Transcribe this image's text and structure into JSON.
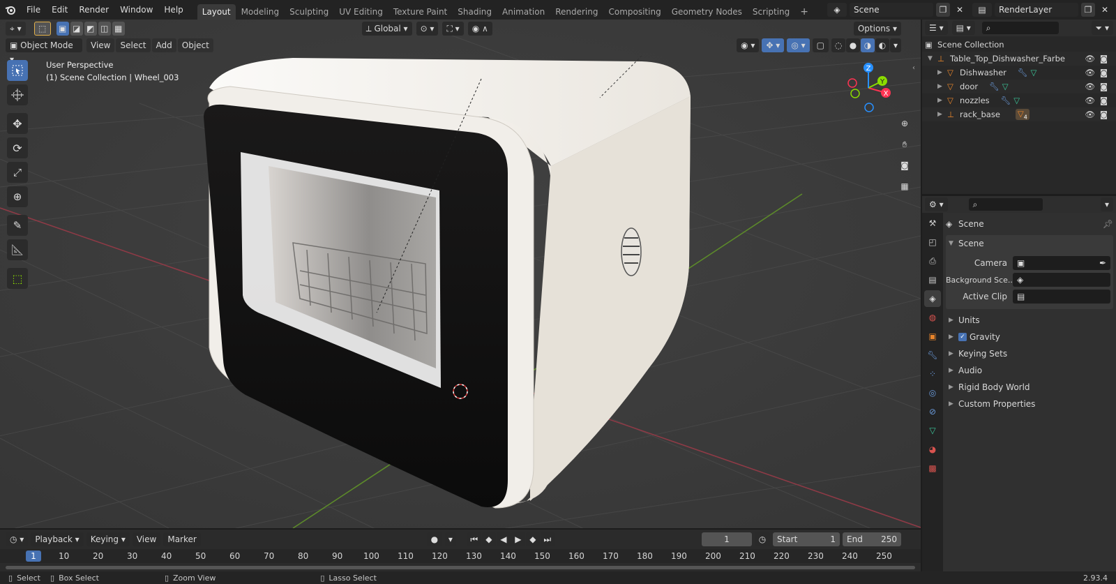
{
  "topbar": {
    "menus": [
      "File",
      "Edit",
      "Render",
      "Window",
      "Help"
    ],
    "workspaces": [
      "Layout",
      "Modeling",
      "Sculpting",
      "UV Editing",
      "Texture Paint",
      "Shading",
      "Animation",
      "Rendering",
      "Compositing",
      "Geometry Nodes",
      "Scripting"
    ],
    "active_workspace": "Layout",
    "scene": "Scene",
    "view_layer": "RenderLayer"
  },
  "viewport": {
    "mode": "Object Mode",
    "menus": [
      "View",
      "Select",
      "Add",
      "Object"
    ],
    "orientation": "Global",
    "options_label": "Options",
    "overlay_line1": "User Perspective",
    "overlay_line2": "(1) Scene Collection | Wheel_003",
    "gizmo": {
      "x": "X",
      "y": "Y",
      "z": "Z"
    }
  },
  "outliner": {
    "root": "Scene Collection",
    "collection": "Table_Top_Dishwasher_Farbe",
    "items": [
      {
        "name": "Dishwasher"
      },
      {
        "name": "door"
      },
      {
        "name": "nozzles"
      },
      {
        "name": "rack_base",
        "badge": "4"
      }
    ]
  },
  "properties": {
    "context_title": "Scene",
    "panel_title": "Scene",
    "fields": [
      {
        "label": "Camera"
      },
      {
        "label": "Background Sce..."
      },
      {
        "label": "Active Clip"
      }
    ],
    "subpanels": [
      "Units",
      "Gravity",
      "Keying Sets",
      "Audio",
      "Rigid Body World",
      "Custom Properties"
    ]
  },
  "timeline": {
    "menus": [
      "Playback",
      "Keying",
      "View",
      "Marker"
    ],
    "current_frame": "1",
    "start_label": "Start",
    "start": "1",
    "end_label": "End",
    "end": "250",
    "ruler": [
      "1",
      "10",
      "20",
      "30",
      "40",
      "50",
      "60",
      "70",
      "80",
      "90",
      "100",
      "110",
      "120",
      "130",
      "140",
      "150",
      "160",
      "170",
      "180",
      "190",
      "200",
      "210",
      "220",
      "230",
      "240",
      "250"
    ]
  },
  "status": {
    "select": "Select",
    "box_select": "Box Select",
    "zoom_view": "Zoom View",
    "lasso_select": "Lasso Select",
    "version": "2.93.4"
  },
  "colors": {
    "accent": "#4772b3",
    "x_axis": "#ff3352",
    "y_axis": "#8bdc00",
    "z_axis": "#2890ff",
    "object_orange": "#e8852b"
  }
}
